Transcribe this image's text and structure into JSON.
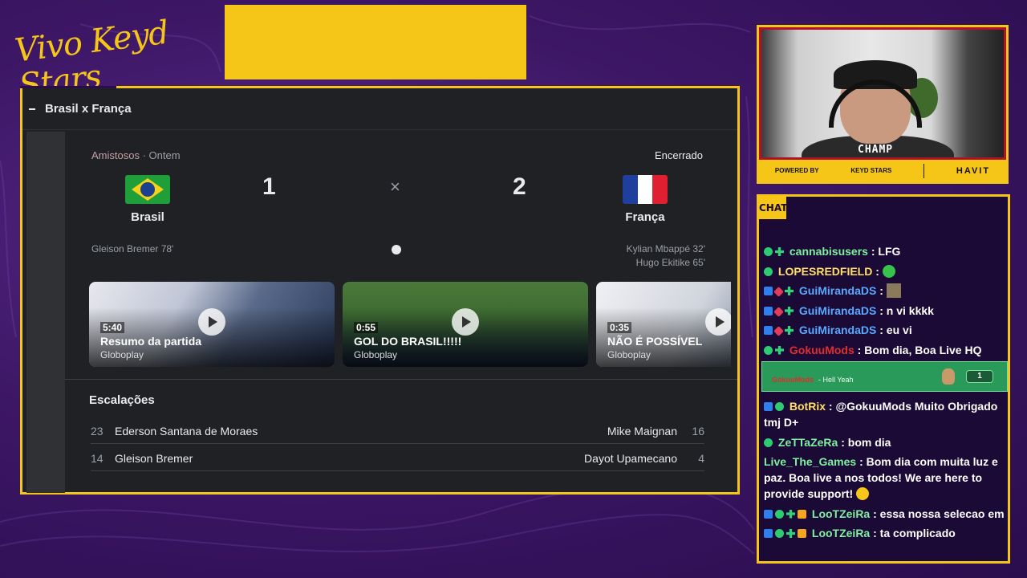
{
  "overlay": {
    "logo_text": "Vivo Keyd Stars"
  },
  "search_page": {
    "header_title": "Brasil x França",
    "competition": "Amistosos",
    "date": "· Ontem",
    "status": "Encerrado",
    "home_team": "Brasil",
    "away_team": "França",
    "home_score": "1",
    "away_score": "2",
    "vs_symbol": "×",
    "home_scorers": [
      "Gleison Bremer 78'"
    ],
    "away_scorers": [
      "Kylian Mbappé 32'",
      "Hugo Ekitike 65'"
    ],
    "videos": [
      {
        "duration": "5:40",
        "title": "Resumo da partida",
        "source": "Globoplay"
      },
      {
        "duration": "0:55",
        "title": "GOL DO BRASIL!!!!!",
        "source": "Globoplay"
      },
      {
        "duration": "0:35",
        "title": "NÃO É POSSÍVEL",
        "source": "Globoplay"
      }
    ],
    "lineups_title": "Escalações",
    "lineups": [
      {
        "home_num": "23",
        "home_name": "Ederson Santana de Moraes",
        "away_name": "Mike Maignan",
        "away_num": "16"
      },
      {
        "home_num": "14",
        "home_name": "Gleison Bremer",
        "away_name": "Dayot Upamecano",
        "away_num": "4"
      }
    ]
  },
  "webcam": {
    "champ_label": "CHAMP",
    "powered_by": "POWERED BY",
    "sponsor1": "KEYD STARS",
    "sponsor2": "HAVIT"
  },
  "chat": {
    "tab_label": "CHAT",
    "messages": [
      {
        "user": "cannabisusers",
        "text": ": LFG"
      },
      {
        "user": "LOPESREDFIELD",
        "text": ":"
      },
      {
        "user": "GuiMirandaDS",
        "text": ":"
      },
      {
        "user": "GuiMirandaDS",
        "text": ": n vi kkkk"
      },
      {
        "user": "GuiMirandaDS",
        "text": ": eu vi"
      },
      {
        "user": "GokuuMods",
        "text": ": Bom dia, Boa Live HQ"
      },
      {
        "user": "BotRix",
        "text": ": @GokuuMods Muito Obrigado tmj D+"
      },
      {
        "user": "ZeTTaZeRa",
        "text": ": bom dia"
      },
      {
        "user": "Live_The_Games",
        "text": ": Bom dia com muita luz e paz. Boa live a nos todos! We are here to provide support!"
      },
      {
        "user": "LooTZeiRa",
        "text": ": essa nossa selecao em"
      },
      {
        "user": "LooTZeiRa",
        "text": ": ta complicado"
      }
    ],
    "highlight": {
      "user": "GokuuMods",
      "text": "- Hell Yeah",
      "count": "1"
    }
  },
  "colors": {
    "accent": "#f5c518",
    "background": "#3d1766",
    "page_bg": "#202124"
  }
}
